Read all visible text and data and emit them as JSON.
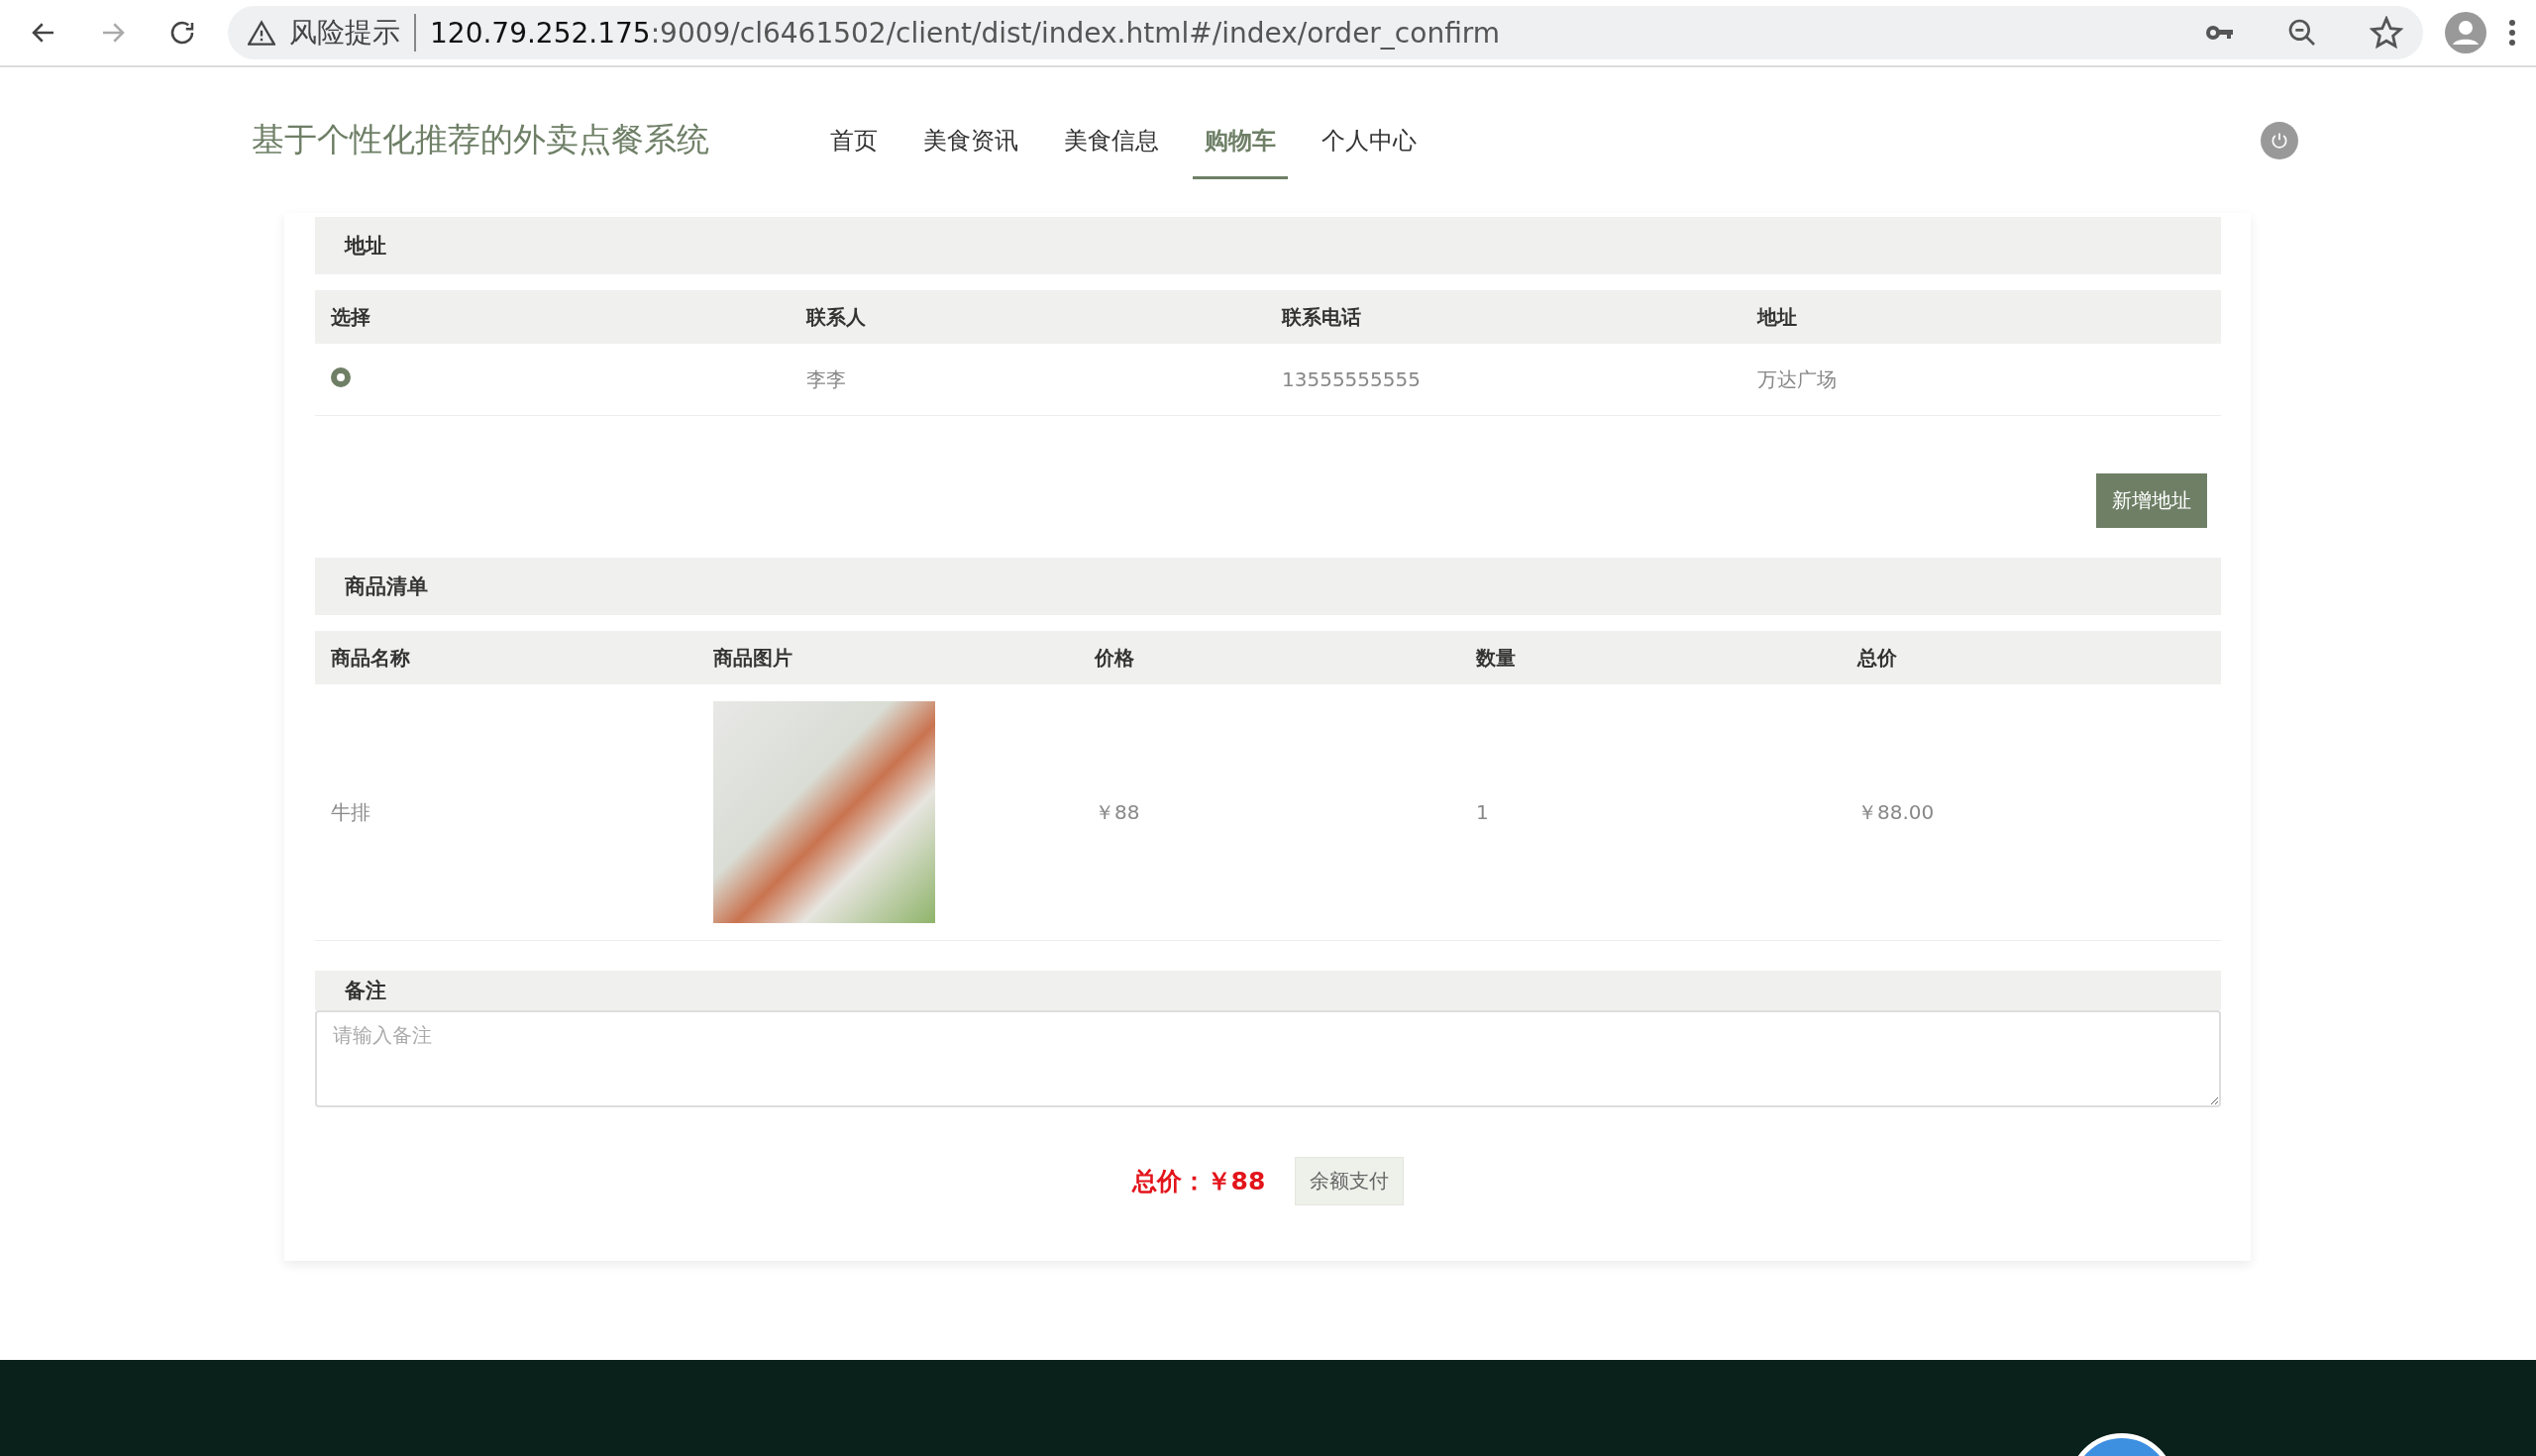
{
  "browser": {
    "warning": "风险提示",
    "url_host": "120.79.252.175",
    "url_rest": ":9009/cl6461502/client/dist/index.html#/index/order_confirm"
  },
  "site": {
    "title": "基于个性化推荐的外卖点餐系统",
    "nav": [
      {
        "label": "首页",
        "selected": false
      },
      {
        "label": "美食资讯",
        "selected": false
      },
      {
        "label": "美食信息",
        "selected": false
      },
      {
        "label": "购物车",
        "selected": true
      },
      {
        "label": "个人中心",
        "selected": false
      }
    ]
  },
  "address": {
    "heading": "地址",
    "columns": [
      "选择",
      "联系人",
      "联系电话",
      "地址"
    ],
    "rows": [
      {
        "selected": true,
        "contact": "李李",
        "phone": "13555555555",
        "address": "万达广场"
      }
    ],
    "add_button": "新增地址"
  },
  "goods": {
    "heading": "商品清单",
    "columns": [
      "商品名称",
      "商品图片",
      "价格",
      "数量",
      "总价"
    ],
    "rows": [
      {
        "name": "牛排",
        "price": "￥88",
        "quantity": "1",
        "total": "￥88.00"
      }
    ]
  },
  "remark": {
    "heading": "备注",
    "placeholder": "请输入备注"
  },
  "summary": {
    "total_label": "总价：",
    "total_value": "￥88",
    "pay_button": "余额支付"
  }
}
